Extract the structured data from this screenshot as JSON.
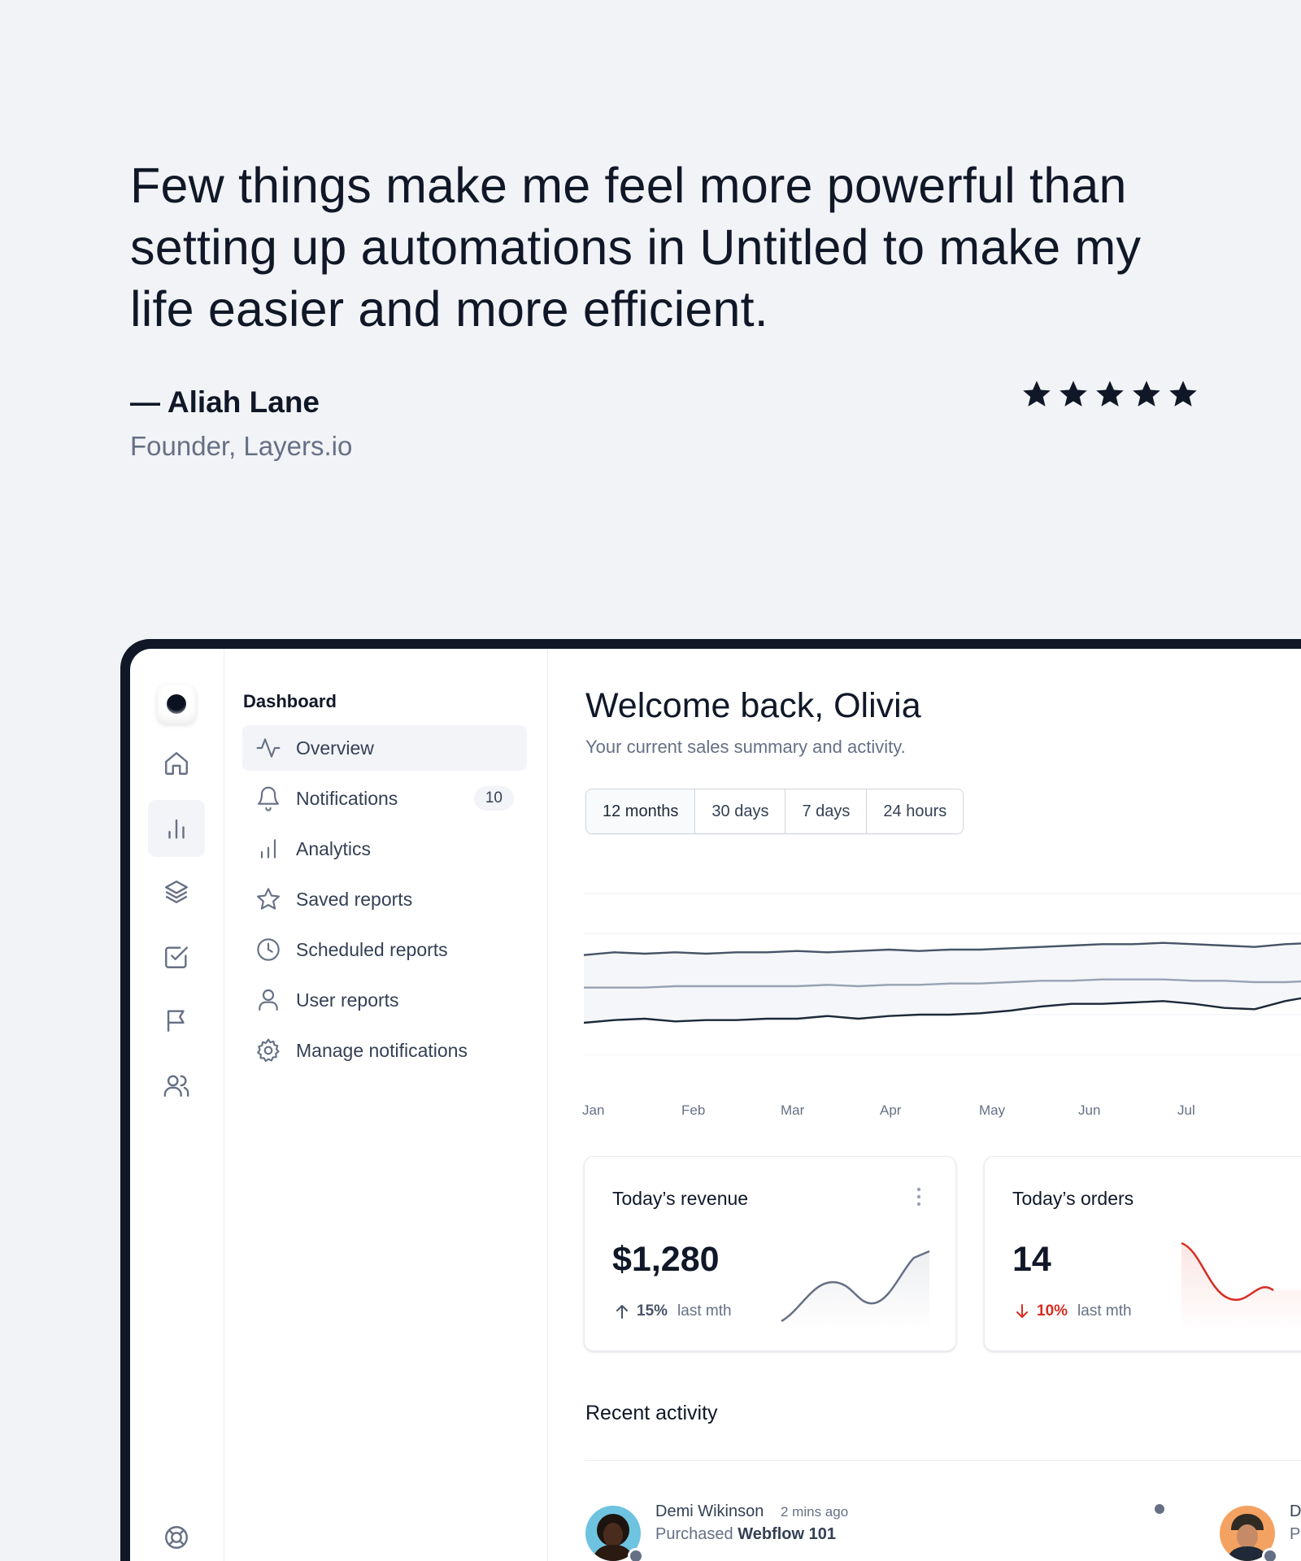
{
  "testimonial": {
    "quote": "Few things make me feel more powerful than setting up automations in Untitled to make my life easier and more efficient.",
    "author": "— Aliah Lane",
    "role": "Founder, Layers.io",
    "rating": 5
  },
  "rail": {
    "icons": [
      "home-icon",
      "bar-chart-icon",
      "layers-icon",
      "check-square-icon",
      "flag-icon",
      "users-icon",
      "life-buoy-icon"
    ],
    "active": "bar-chart-icon"
  },
  "subnav": {
    "title": "Dashboard",
    "items": [
      {
        "label": "Overview",
        "icon": "activity-icon",
        "active": true
      },
      {
        "label": "Notifications",
        "icon": "bell-icon",
        "badge": "10"
      },
      {
        "label": "Analytics",
        "icon": "bar-chart-icon"
      },
      {
        "label": "Saved reports",
        "icon": "star-icon"
      },
      {
        "label": "Scheduled reports",
        "icon": "clock-icon"
      },
      {
        "label": "User reports",
        "icon": "user-icon"
      },
      {
        "label": "Manage notifications",
        "icon": "settings-icon"
      }
    ]
  },
  "main": {
    "welcome": "Welcome back, Olivia",
    "subtitle": "Your current sales summary and activity.",
    "tabs": [
      "12 months",
      "30 days",
      "7 days",
      "24 hours"
    ],
    "active_tab": "12 months"
  },
  "chart_data": {
    "type": "line",
    "categories": [
      "Jan",
      "Feb",
      "Mar",
      "Apr",
      "May",
      "Jun",
      "Jul"
    ],
    "series": [
      {
        "values": [
          46,
          44,
          45,
          44,
          45,
          44,
          44,
          43,
          44,
          43,
          42,
          43,
          42,
          42,
          41,
          40,
          39,
          38,
          38,
          37,
          38,
          39,
          40,
          38,
          37
        ]
      },
      {
        "values": [
          70,
          70,
          70,
          69,
          69,
          69,
          69,
          69,
          68,
          69,
          68,
          68,
          67,
          67,
          66,
          65,
          65,
          64,
          64,
          64,
          65,
          65,
          66,
          66,
          65
        ]
      },
      {
        "values": [
          96,
          94,
          93,
          95,
          94,
          94,
          93,
          93,
          91,
          93,
          91,
          90,
          90,
          89,
          87,
          84,
          82,
          82,
          81,
          80,
          82,
          85,
          86,
          80,
          76
        ]
      }
    ],
    "grid": true
  },
  "cards": [
    {
      "title": "Today’s revenue",
      "value": "$1,280",
      "delta": "15%",
      "delta_dir": "up",
      "delta_label": "last mth",
      "color": "#475467"
    },
    {
      "title": "Today’s orders",
      "value": "14",
      "delta": "10%",
      "delta_dir": "down",
      "delta_label": "last mth",
      "color": "#d92d20"
    }
  ],
  "activity": {
    "title": "Recent activity",
    "items": [
      {
        "name": "Demi Wikinson",
        "time": "2 mins ago",
        "action": "Purchased",
        "target": "Webflow 101"
      },
      {
        "name": "Dre",
        "action": "Pur"
      }
    ]
  },
  "colors": {
    "accent": "#101828",
    "muted": "#667085",
    "danger": "#d92d20",
    "border": "#eaecf0"
  }
}
